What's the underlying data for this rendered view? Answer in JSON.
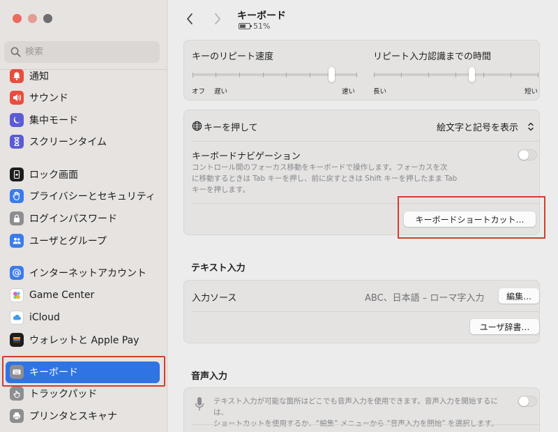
{
  "sidebar": {
    "search_placeholder": "検索",
    "items": [
      {
        "label": "通知",
        "icon": "bell-icon",
        "color": "#ea4c3d"
      },
      {
        "label": "サウンド",
        "icon": "speaker-icon",
        "color": "#ea4c3d"
      },
      {
        "label": "集中モード",
        "icon": "moon-icon",
        "color": "#5b5bd6"
      },
      {
        "label": "スクリーンタイム",
        "icon": "hourglass-icon",
        "color": "#5b5bd6"
      },
      {
        "label": "ロック画面",
        "icon": "lock-screen-icon",
        "color": "#1d1d1f"
      },
      {
        "label": "プライバシーとセキュリティ",
        "icon": "hand-icon",
        "color": "#3b7bec"
      },
      {
        "label": "ログインパスワード",
        "icon": "lock-icon",
        "color": "#8e8e92"
      },
      {
        "label": "ユーザとグループ",
        "icon": "users-icon",
        "color": "#3b7bec"
      },
      {
        "label": "インターネットアカウント",
        "icon": "at-icon",
        "color": "#3b7bec"
      },
      {
        "label": "Game Center",
        "icon": "game-center-icon",
        "color": "#ffffff"
      },
      {
        "label": "iCloud",
        "icon": "cloud-icon",
        "color": "#ffffff"
      },
      {
        "label": "ウォレットと Apple Pay",
        "icon": "wallet-icon",
        "color": "#1d1d1f"
      },
      {
        "label": "キーボード",
        "icon": "keyboard-icon",
        "color": "#8e8e92"
      },
      {
        "label": "トラックパッド",
        "icon": "trackpad-icon",
        "color": "#8e8e92"
      },
      {
        "label": "プリンタとスキャナ",
        "icon": "printer-icon",
        "color": "#8e8e92"
      }
    ]
  },
  "header": {
    "title": "キーボード",
    "battery": "51%"
  },
  "repeat": {
    "rate_label": "キーのリピート速度",
    "rate_left": "オフ",
    "rate_left2": "遅い",
    "rate_right": "速い",
    "delay_label": "リピート入力認識までの時間",
    "delay_left": "長い",
    "delay_right": "短い"
  },
  "keyboard_settings": {
    "press_key_label": "キーを押して",
    "press_key_value": "絵文字と記号を表示",
    "nav_label": "キーボードナビゲーション",
    "nav_desc_1": "コントロール間のフォーカス移動をキーボードで操作します。フォーカスを次",
    "nav_desc_2": "に移動するときは Tab キーを押し、前に戻すときは Shift キーを押したまま Tab",
    "nav_desc_3": "キーを押します。",
    "shortcuts_button": "キーボードショートカット…"
  },
  "text_input": {
    "section": "テキスト入力",
    "source_label": "入力ソース",
    "source_value": "ABC、日本語 – ローマ字入力",
    "edit_button": "編集…",
    "dictionary_button": "ユーザ辞書…"
  },
  "dictation": {
    "section": "音声入力",
    "desc_1": "テキスト入力が可能な箇所はどこでも音声入力を使用できます。音声入力を開始するには、",
    "desc_2": "ショートカットを使用するか、“編集” メニューから “音声入力を開始” を選択します。"
  }
}
